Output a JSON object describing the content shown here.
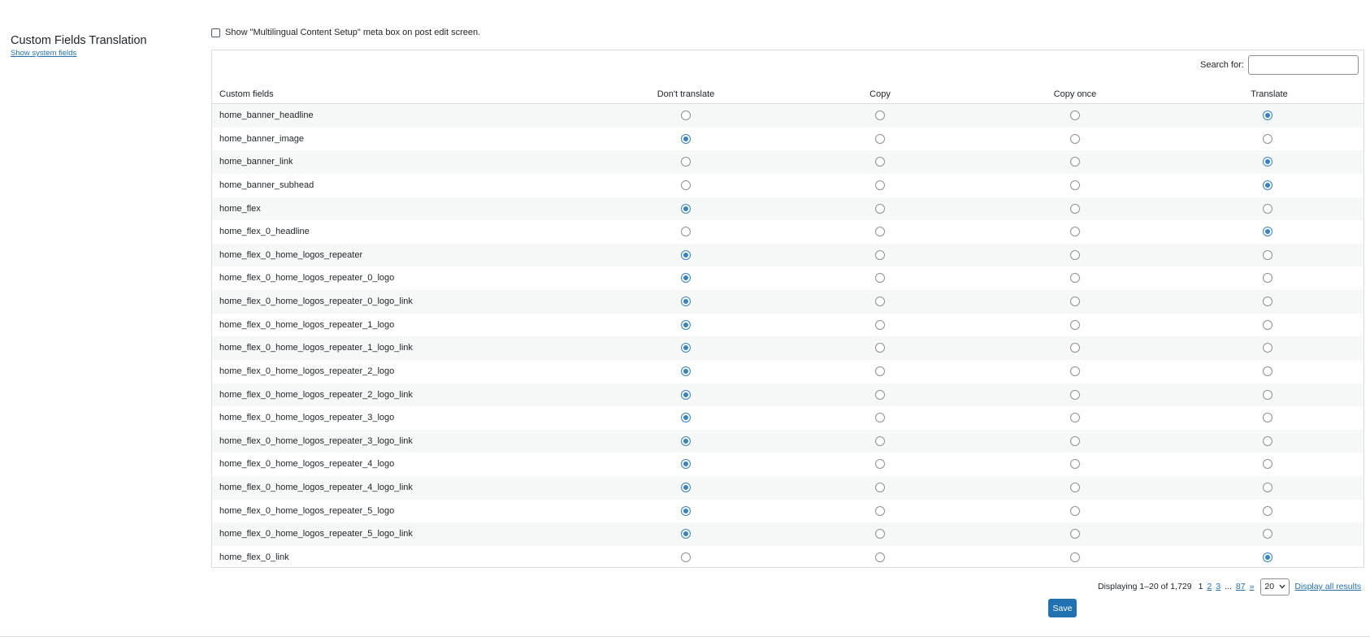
{
  "section": {
    "title": "Custom Fields Translation",
    "system_link": "Show system fields"
  },
  "metabox_option": {
    "label": "Show \"Multilingual Content Setup\" meta box on post edit screen.",
    "checked": false
  },
  "search": {
    "label": "Search for:",
    "value": ""
  },
  "table": {
    "columns": [
      "Custom fields",
      "Don't translate",
      "Copy",
      "Copy once",
      "Translate"
    ],
    "rows": [
      {
        "name": "home_banner_headline",
        "selected": 3
      },
      {
        "name": "home_banner_image",
        "selected": 0
      },
      {
        "name": "home_banner_link",
        "selected": 3
      },
      {
        "name": "home_banner_subhead",
        "selected": 3
      },
      {
        "name": "home_flex",
        "selected": 0
      },
      {
        "name": "home_flex_0_headline",
        "selected": 3
      },
      {
        "name": "home_flex_0_home_logos_repeater",
        "selected": 0
      },
      {
        "name": "home_flex_0_home_logos_repeater_0_logo",
        "selected": 0
      },
      {
        "name": "home_flex_0_home_logos_repeater_0_logo_link",
        "selected": 0
      },
      {
        "name": "home_flex_0_home_logos_repeater_1_logo",
        "selected": 0
      },
      {
        "name": "home_flex_0_home_logos_repeater_1_logo_link",
        "selected": 0
      },
      {
        "name": "home_flex_0_home_logos_repeater_2_logo",
        "selected": 0
      },
      {
        "name": "home_flex_0_home_logos_repeater_2_logo_link",
        "selected": 0
      },
      {
        "name": "home_flex_0_home_logos_repeater_3_logo",
        "selected": 0
      },
      {
        "name": "home_flex_0_home_logos_repeater_3_logo_link",
        "selected": 0
      },
      {
        "name": "home_flex_0_home_logos_repeater_4_logo",
        "selected": 0
      },
      {
        "name": "home_flex_0_home_logos_repeater_4_logo_link",
        "selected": 0
      },
      {
        "name": "home_flex_0_home_logos_repeater_5_logo",
        "selected": 0
      },
      {
        "name": "home_flex_0_home_logos_repeater_5_logo_link",
        "selected": 0
      },
      {
        "name": "home_flex_0_link",
        "selected": 3
      }
    ]
  },
  "pagination": {
    "summary": "Displaying 1–20 of 1,729",
    "current_page": "1",
    "pages": [
      "2",
      "3"
    ],
    "ellipsis": "...",
    "last_page": "87",
    "next": "»",
    "per_page": "20",
    "display_all": "Display all results"
  },
  "save_label": "Save",
  "colors": {
    "accent": "#2271b1",
    "radio_checked": "#3582c4",
    "row_stripe": "#f6f7f7"
  }
}
